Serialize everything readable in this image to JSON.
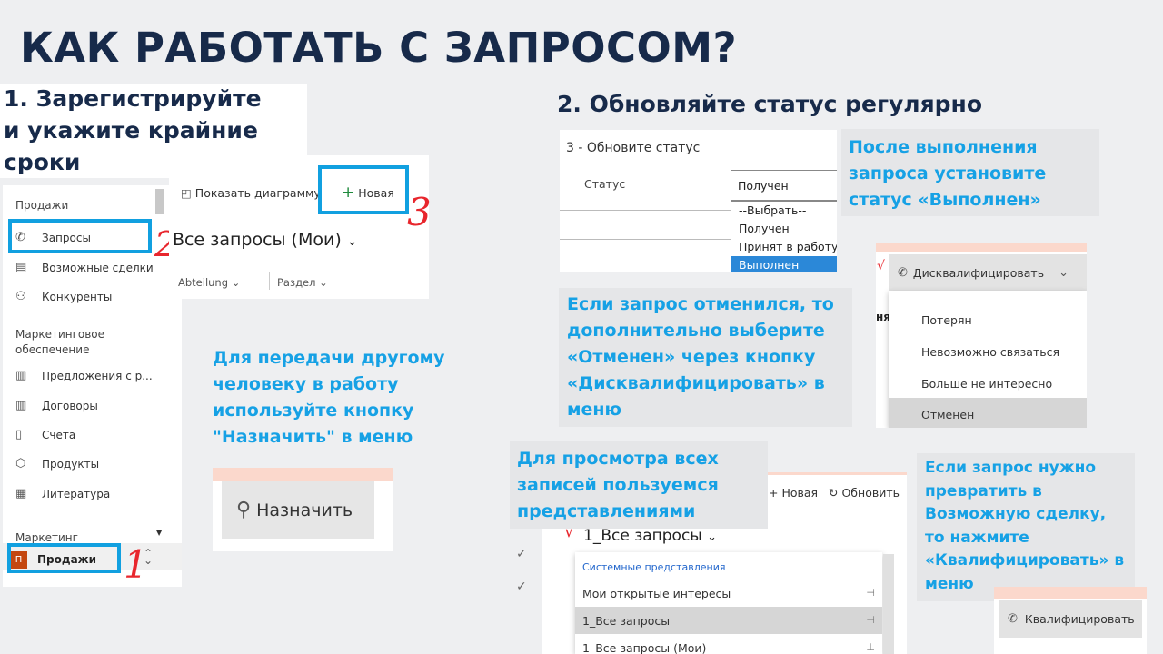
{
  "slide": {
    "title": "КАК РАБОТАТЬ С ЗАПРОСОМ?",
    "step1_line1": "1. Зарегистрируйте",
    "step1_line2": "и укажите крайние",
    "step1_line3": "сроки",
    "step2": "2. Обновляйте статус регулярно"
  },
  "sidebar": {
    "section1": "Продажи",
    "items1": [
      {
        "label": "Запросы",
        "icon": "phone-icon"
      },
      {
        "label": "Возможные сделки",
        "icon": "opportunity-icon"
      },
      {
        "label": "Конкуренты",
        "icon": "person-icon"
      }
    ],
    "section2_line1": "Маркетинговое",
    "section2_line2": "обеспечение",
    "items2": [
      {
        "label": "Предложения с р...",
        "icon": "document-icon"
      },
      {
        "label": "Договоры",
        "icon": "document-icon"
      },
      {
        "label": "Счета",
        "icon": "invoice-icon"
      },
      {
        "label": "Продукты",
        "icon": "cube-icon"
      },
      {
        "label": "Литература",
        "icon": "book-icon"
      }
    ],
    "section3": "Маркетинг",
    "area_avatar": "П",
    "area_label": "Продажи",
    "marker": "1"
  },
  "toolbar1": {
    "show_chart": "Показать диаграмму",
    "new": "Новая",
    "view_title": "Все запросы (Мои)",
    "col1": "Abteilung",
    "col2": "Раздел",
    "marker2": "2",
    "marker3": "3"
  },
  "assign": {
    "text_line1": "Для передачи другому",
    "text_line2": "человеку в работу",
    "text_line3": "используйте кнопку",
    "text_line4": "\"Назначить\" в меню",
    "button": "Назначить"
  },
  "status": {
    "section_title": "3 - Обновите статус",
    "field_label": "Статус",
    "value": "Получен",
    "options": [
      "--Выбрать--",
      "Получен",
      "Принят в работу",
      "Выполнен"
    ],
    "selected_index": 3
  },
  "done_note": {
    "line1": "После выполнения",
    "line2": "запроса установите",
    "line3": "статус «Выполнен»"
  },
  "cancel_note": {
    "line1": "Если запрос отменился, то",
    "line2": "дополнительно выберите",
    "line3": "«Отменен» через кнопку",
    "line4": "«Дисквалифицировать» в",
    "line5": "меню"
  },
  "disqualify": {
    "button": "Дисквалифицировать",
    "items": [
      "Потерян",
      "Невозможно связаться",
      "Больше не интересно",
      "Отменен"
    ],
    "selected_index": 3,
    "cut_text": "ня"
  },
  "views_note": {
    "line1": "Для просмотра всех",
    "line2": "записей пользуемся",
    "line3": "представлениями"
  },
  "views": {
    "new": "Новая",
    "refresh": "Обновить",
    "title": "1_Все запросы",
    "group": "Системные представления",
    "items": [
      {
        "label": "Мои открытые интересы",
        "pin": "pin-icon"
      },
      {
        "label": "1_Все запросы",
        "pin": "pin-icon"
      },
      {
        "label": "1_Все запросы (Мои)",
        "pin": "pin-icon"
      }
    ],
    "selected_index": 1
  },
  "qualify_note": {
    "line1": "Если запрос нужно",
    "line2": "превратить в",
    "line3": "Возможную сделку,",
    "line4": "то нажмите",
    "line5": "«Квалифицировать» в",
    "line6": "меню"
  },
  "qualify": {
    "button": "Квалифицировать"
  },
  "colors": {
    "title": "#172a4a",
    "accent": "#16a1e5",
    "frame": "#11a0e0",
    "marker": "#e8262d",
    "selected": "#2b88d8",
    "peach": "#fbd8cc"
  }
}
